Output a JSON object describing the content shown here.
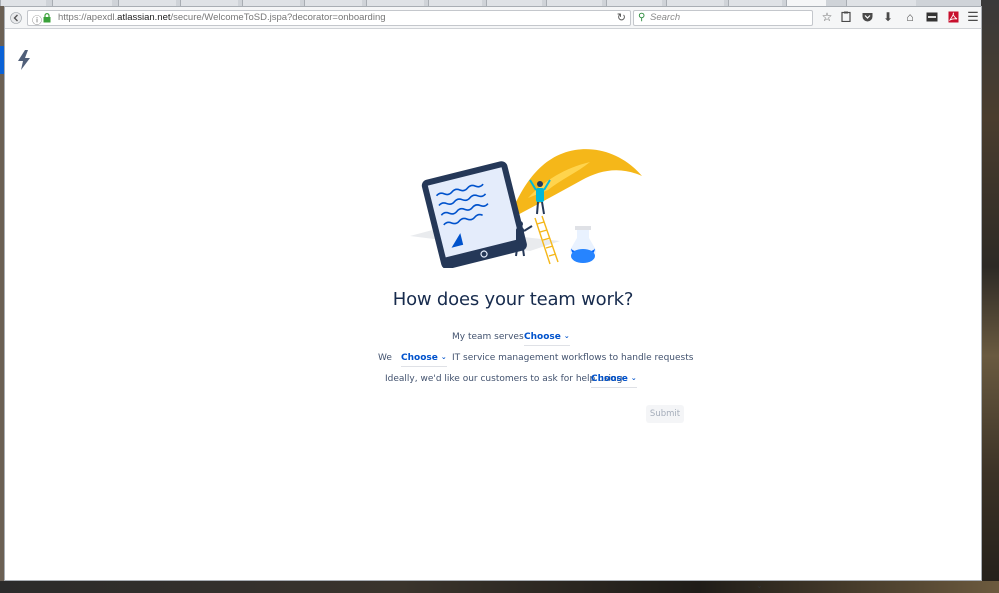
{
  "browser": {
    "url_prefix": "https://apexdl.",
    "url_domain": "atlassian.net",
    "url_path": "/secure/WelcomeToSD.jspa?decorator=onboarding",
    "search_placeholder": "Search"
  },
  "page": {
    "heading": "How does your team work?",
    "row1": {
      "label": "My team serves",
      "choose": "Choose"
    },
    "row2": {
      "prefix": "We",
      "choose": "Choose",
      "suffix": "IT service management workflows to handle requests"
    },
    "row3": {
      "label": "Ideally, we'd like our customers to ask for help using",
      "choose": "Choose"
    },
    "submit_label": "Submit"
  },
  "colors": {
    "heading": "#172b4d",
    "link": "#0052cc",
    "text": "#42526e",
    "quill": "#f5b719",
    "tablet": "#253858"
  }
}
